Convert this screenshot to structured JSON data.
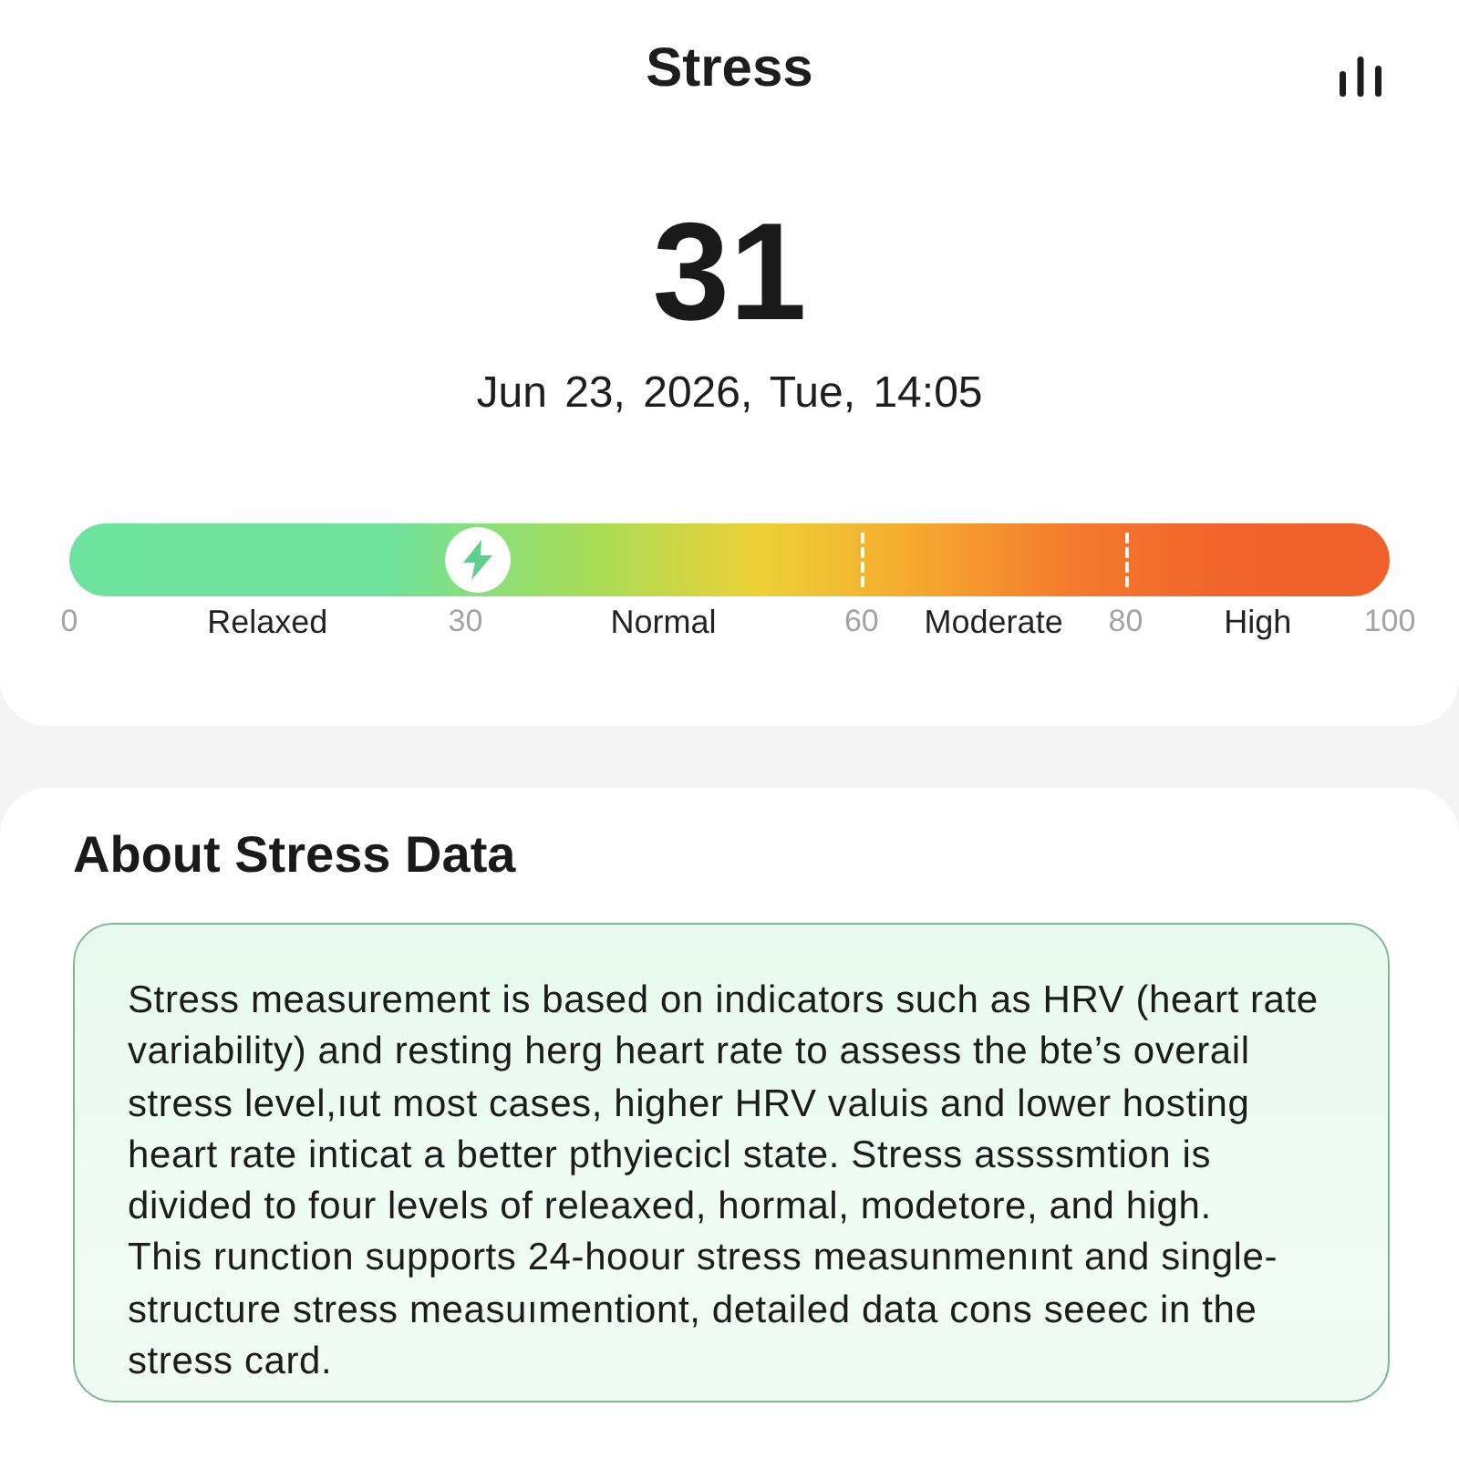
{
  "header": {
    "title": "Stress"
  },
  "reading": {
    "value": "31",
    "timestamp": "Jun 23, 2026, Tue, 14:05"
  },
  "gauge": {
    "level": 0.31,
    "ticks": [
      "0",
      "30",
      "60",
      "80",
      "100"
    ],
    "zones": [
      "Relaxed",
      "Normal",
      "Moderate",
      "High"
    ]
  },
  "about": {
    "title": "About Stress Data",
    "lines": [
      "Stress measurement is based on indicators such as HRV (heart rate",
      "variability) and resting herg heart rate to assess the bte’s overail",
      "stress level,ıut most cases, higher HRV valuis and lower hosting",
      "heart rate inticat a better pthyiecicl state. Stress assssmtion is",
      "divided to four levels of releaxed, hormal, modetore, and high.",
      "This runction supports 24-hoour stress measunmenınt and single-",
      "structure stress measuımentiont, detailed data cons seeec in the",
      "stress card."
    ]
  }
}
